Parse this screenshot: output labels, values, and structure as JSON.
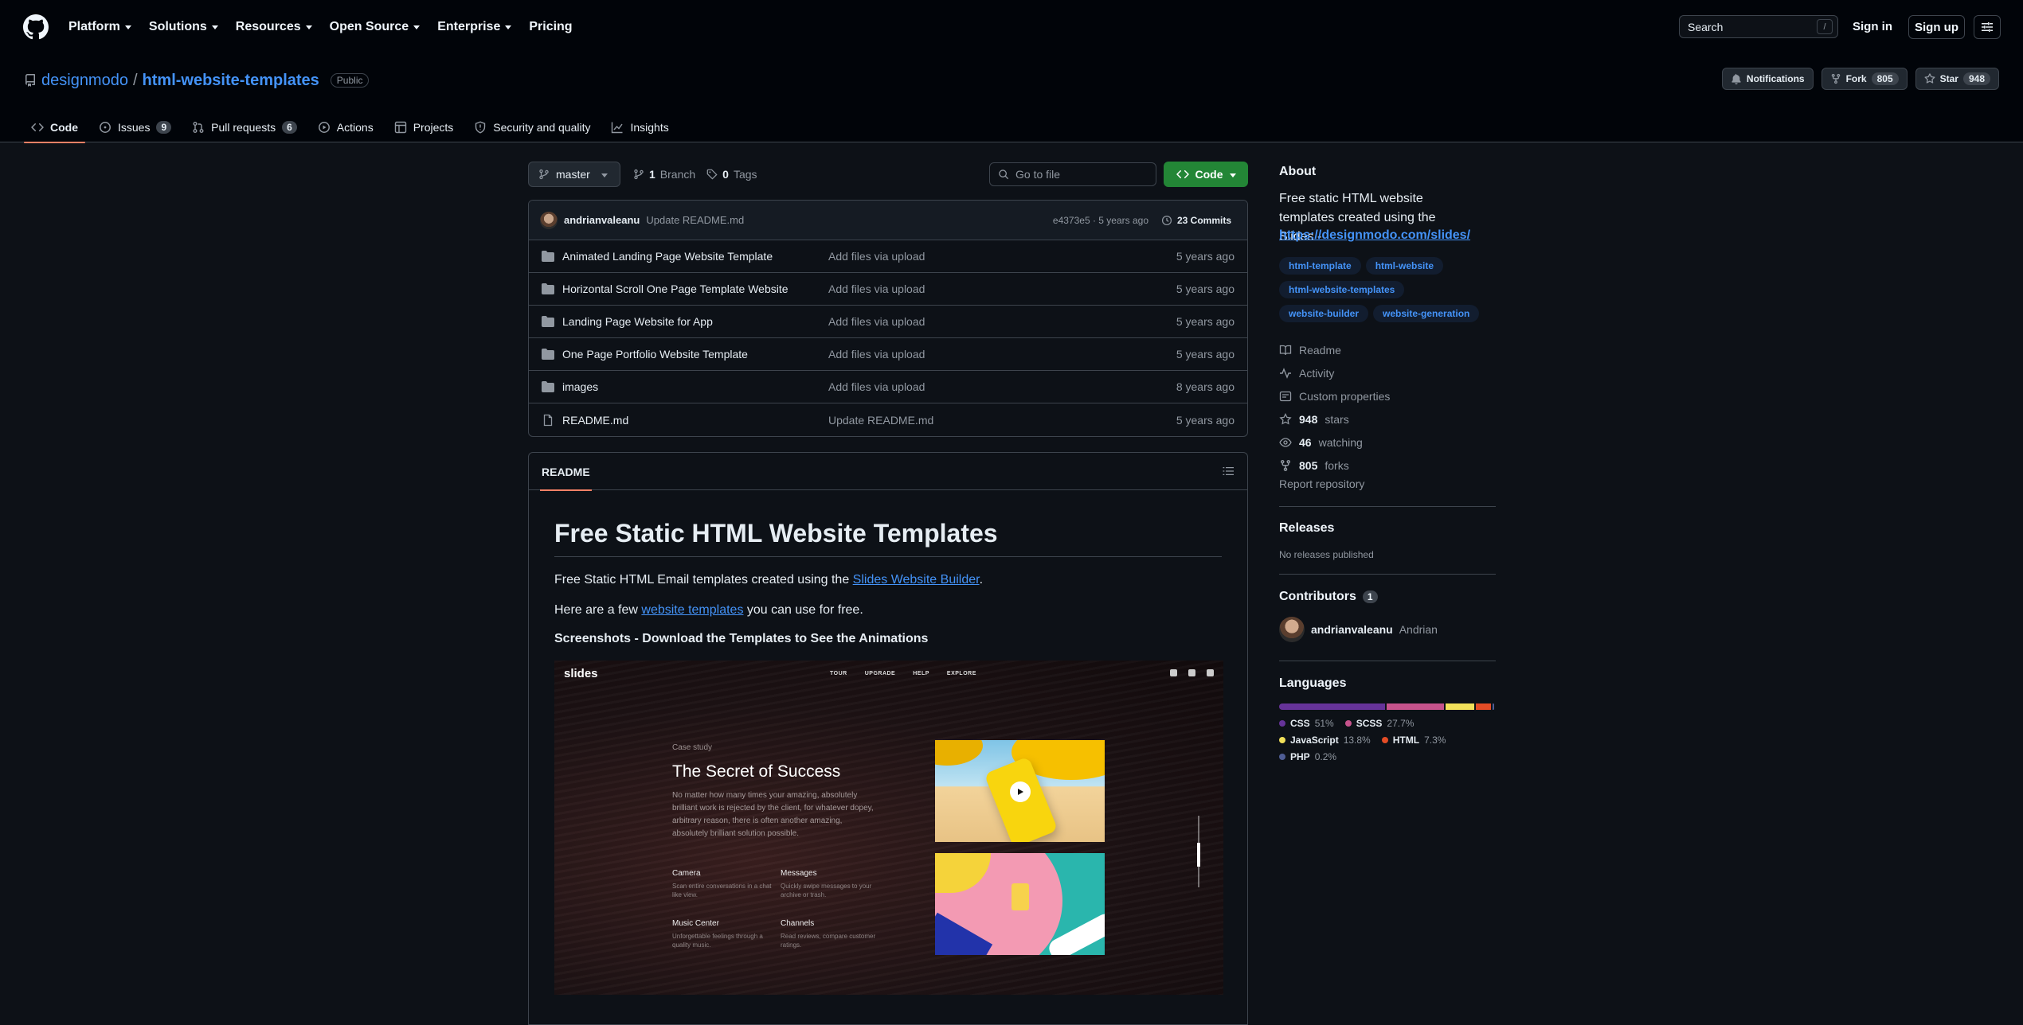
{
  "nav": {
    "items": [
      "Platform",
      "Solutions",
      "Resources",
      "Open Source",
      "Enterprise",
      "Pricing"
    ],
    "search_label": "Search",
    "search_key": "/",
    "sign_in": "Sign in",
    "sign_up": "Sign up"
  },
  "repo": {
    "owner": "designmodo",
    "name": "html-website-templates",
    "visibility": "Public",
    "notifications_label": "Notifications",
    "fork_label": "Fork",
    "fork_count": "805",
    "star_label": "Star",
    "star_count": "948"
  },
  "tabs": [
    {
      "label": "Code",
      "count": null,
      "icon": "code-icon"
    },
    {
      "label": "Issues",
      "count": "9",
      "icon": "issue-icon"
    },
    {
      "label": "Pull requests",
      "count": "6",
      "icon": "pull-request-icon"
    },
    {
      "label": "Actions",
      "count": null,
      "icon": "play-icon"
    },
    {
      "label": "Projects",
      "count": null,
      "icon": "table-icon"
    },
    {
      "label": "Security and quality",
      "count": null,
      "icon": "shield-icon"
    },
    {
      "label": "Insights",
      "count": null,
      "icon": "graph-icon"
    }
  ],
  "toolbar": {
    "branch": "master",
    "branches_count": "1",
    "branches_label": "Branch",
    "tags_count": "0",
    "tags_label": "Tags",
    "goto_placeholder": "Go to file",
    "code_label": "Code"
  },
  "commit": {
    "author": "andrianvaleanu",
    "message": "Update README.md",
    "hash_time": "e4373e5 · 5 years ago",
    "count_label": "23 Commits"
  },
  "files": [
    {
      "name": "Animated Landing Page Website Template",
      "message": "Add files via upload",
      "date": "5 years ago",
      "type": "folder"
    },
    {
      "name": "Horizontal Scroll One Page Template Website",
      "message": "Add files via upload",
      "date": "5 years ago",
      "type": "folder"
    },
    {
      "name": "Landing Page Website for App",
      "message": "Add files via upload",
      "date": "5 years ago",
      "type": "folder"
    },
    {
      "name": "One Page Portfolio Website Template",
      "message": "Add files via upload",
      "date": "5 years ago",
      "type": "folder"
    },
    {
      "name": "images",
      "message": "Add files via upload",
      "date": "8 years ago",
      "type": "folder"
    },
    {
      "name": "README.md",
      "message": "Update README.md",
      "date": "5 years ago",
      "type": "file"
    }
  ],
  "readme": {
    "tab_label": "README",
    "title": "Free Static HTML Website Templates",
    "p1_before": "Free Static HTML Email templates created using the ",
    "p1_link": "Slides Website Builder",
    "p1_after": ".",
    "p2_before": "Here are a few ",
    "p2_link": "website templates",
    "p2_after": " you can use for free.",
    "h3": "Screenshots - Download the Templates to See the Animations",
    "shot": {
      "logo": "slides",
      "nav": [
        "TOUR",
        "UPGRADE",
        "HELP",
        "EXPLORE"
      ],
      "kicker": "Case study",
      "title": "The Secret of Success",
      "lead": "No matter how many times your amazing, absolutely brilliant work is rejected by the client, for whatever dopey, arbitrary reason, there is often another amazing, absolutely brilliant solution possible.",
      "features": [
        {
          "title": "Camera",
          "desc": "Scan entire conversations in a chat like view."
        },
        {
          "title": "Messages",
          "desc": "Quickly swipe messages to your archive or trash."
        },
        {
          "title": "Music Center",
          "desc": "Unforgettable feelings through a quality music."
        },
        {
          "title": "Channels",
          "desc": "Read reviews, compare customer ratings."
        }
      ]
    }
  },
  "sidebar": {
    "about_heading": "About",
    "description": "Free static HTML website templates created using the Slides -",
    "link": "https://designmodo.com/slides/",
    "topics": [
      "html-template",
      "html-website",
      "html-website-templates",
      "website-builder",
      "website-generation"
    ],
    "readme_label": "Readme",
    "activity_label": "Activity",
    "custom_props_label": "Custom properties",
    "stars_count": "948",
    "stars_label": "stars",
    "watching_count": "46",
    "watching_label": "watching",
    "forks_count": "805",
    "forks_label": "forks",
    "report_label": "Report repository",
    "releases_heading": "Releases",
    "releases_sub": "No releases published",
    "contributors_heading": "Contributors",
    "contributors_count": "1",
    "contributor_login": "andrianvaleanu",
    "contributor_name": "Andrian",
    "languages_heading": "Languages",
    "languages": [
      {
        "name": "CSS",
        "pct": "51%",
        "value": 51,
        "color": "#663399"
      },
      {
        "name": "SCSS",
        "pct": "27.7%",
        "value": 27.7,
        "color": "#c6538c"
      },
      {
        "name": "JavaScript",
        "pct": "13.8%",
        "value": 13.8,
        "color": "#f1e05a"
      },
      {
        "name": "HTML",
        "pct": "7.3%",
        "value": 7.3,
        "color": "#e34c26"
      },
      {
        "name": "PHP",
        "pct": "0.2%",
        "value": 0.2,
        "color": "#4F5D95"
      }
    ]
  }
}
